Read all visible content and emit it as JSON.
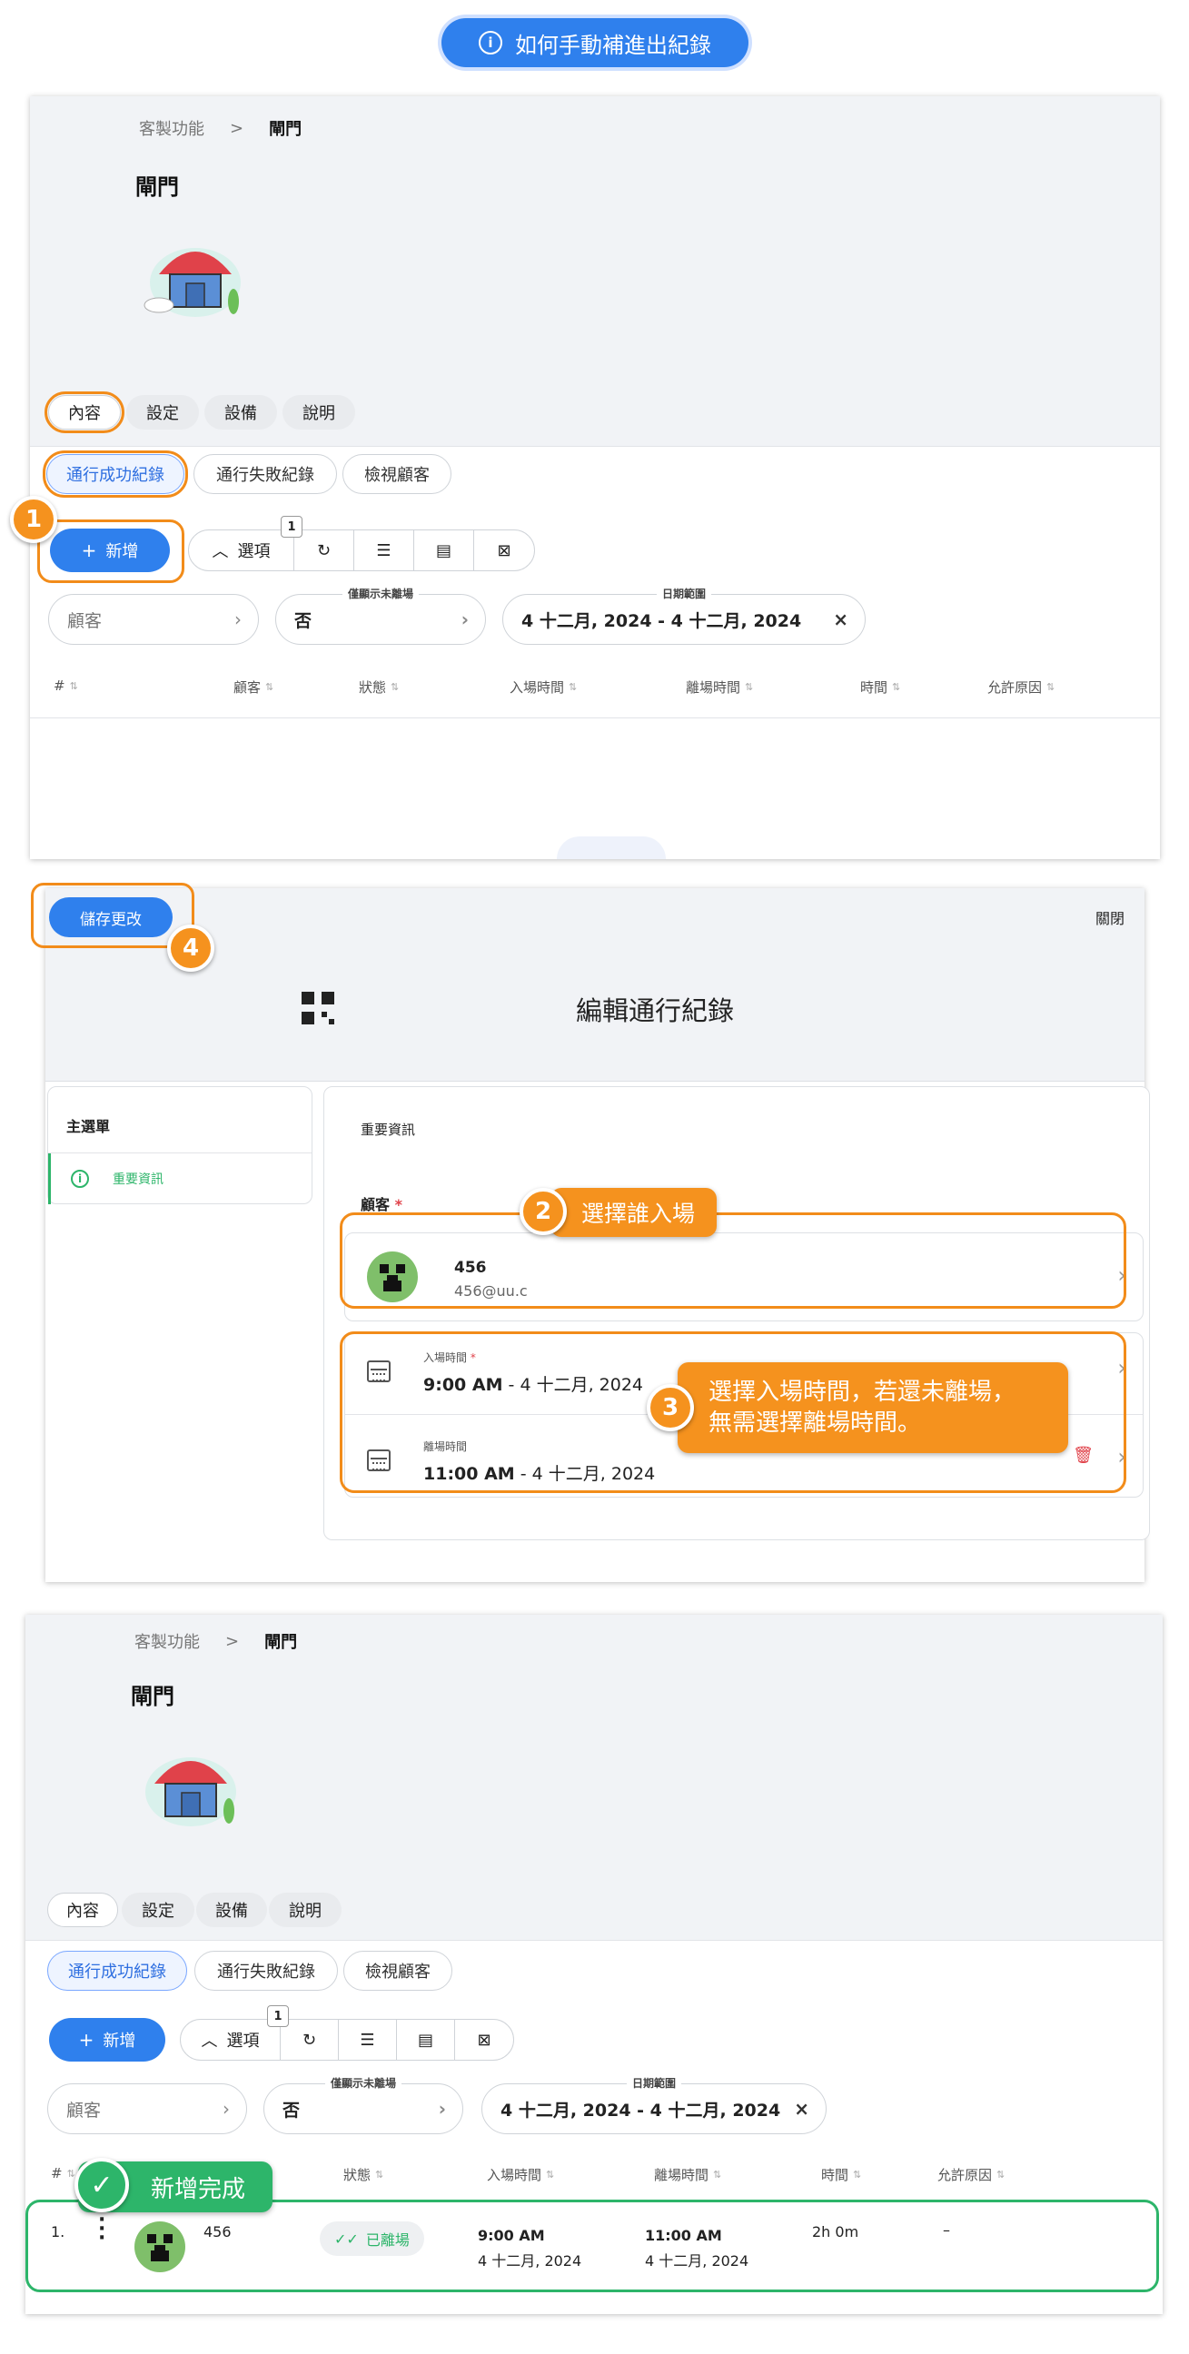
{
  "banner": {
    "text": "如何手動補進出紀錄"
  },
  "breadcrumb": {
    "parent": "客製功能",
    "current": "閘門"
  },
  "page_title": "閘門",
  "tabs": [
    "內容",
    "設定",
    "設備",
    "說明"
  ],
  "sub_tabs": [
    "通行成功紀錄",
    "通行失敗紀錄",
    "檢視顧客"
  ],
  "toolbar": {
    "add_label": "新增",
    "options_label": "選項",
    "badge": "1"
  },
  "filters": {
    "customer_placeholder": "顧客",
    "unfinished_label": "僅顯示未離場",
    "unfinished_value": "否",
    "date_label": "日期範圍",
    "date_value": "4 十二月, 2024 - 4 十二月, 2024"
  },
  "columns": [
    "#",
    "顧客",
    "狀態",
    "入場時間",
    "離場時間",
    "時間",
    "允許原因"
  ],
  "steps": {
    "s1": "1",
    "s2": "2",
    "s3": "3",
    "s4": "4"
  },
  "edit_dialog": {
    "save_label": "儲存更改",
    "close_label": "關閉",
    "title": "編輯通行紀錄",
    "menu_title": "主選單",
    "menu_item": "重要資訊",
    "section_title": "重要資訊",
    "customer_label": "顧客",
    "required_mark": "*",
    "customer_name": "456",
    "customer_email": "456@uu.c",
    "entry_label": "入場時間",
    "entry_time": "9:00 AM",
    "entry_date": "- 4 十二月, 2024",
    "exit_label": "離場時間",
    "exit_time": "11:00 AM",
    "exit_date": "- 4 十二月, 2024"
  },
  "callouts": {
    "c2": "選擇誰入場",
    "c3_line1": "選擇入場時間，若還未離場，",
    "c3_line2": "無需選擇離場時間。",
    "done": "新增完成"
  },
  "result_row": {
    "index": "1.",
    "customer": "456",
    "status": "已離場",
    "entry_time": "9:00 AM",
    "entry_date": "4 十二月, 2024",
    "exit_time": "11:00 AM",
    "exit_date": "4 十二月, 2024",
    "duration": "2h 0m",
    "reason": "–"
  },
  "colors": {
    "accent": "#2f80ed",
    "highlight": "#f5921e",
    "success": "#2db56a"
  }
}
